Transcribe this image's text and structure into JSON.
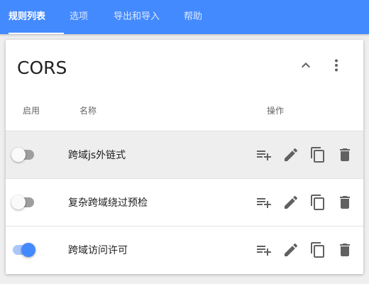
{
  "tabs": [
    {
      "label": "规则列表",
      "active": true
    },
    {
      "label": "选项",
      "active": false
    },
    {
      "label": "导出和导入",
      "active": false
    },
    {
      "label": "帮助",
      "active": false
    }
  ],
  "colors": {
    "primary": "#448aff",
    "icon": "#616161",
    "toggle_off_track": "#9e9e9e",
    "toggle_on_track": "#a9c7fb"
  },
  "card": {
    "title": "CORS",
    "collapse_icon": "chevron-up-icon",
    "more_icon": "more-vert-icon",
    "columns": {
      "enable": "启用",
      "name": "名称",
      "actions": "操作"
    },
    "rules": [
      {
        "name": "跨域js外链式",
        "enabled": false
      },
      {
        "name": "复杂跨域绕过预检",
        "enabled": false
      },
      {
        "name": "跨域访问许可",
        "enabled": true
      }
    ],
    "row_action_icons": [
      "playlist-add-icon",
      "edit-pencil-icon",
      "copy-icon",
      "delete-icon"
    ]
  }
}
